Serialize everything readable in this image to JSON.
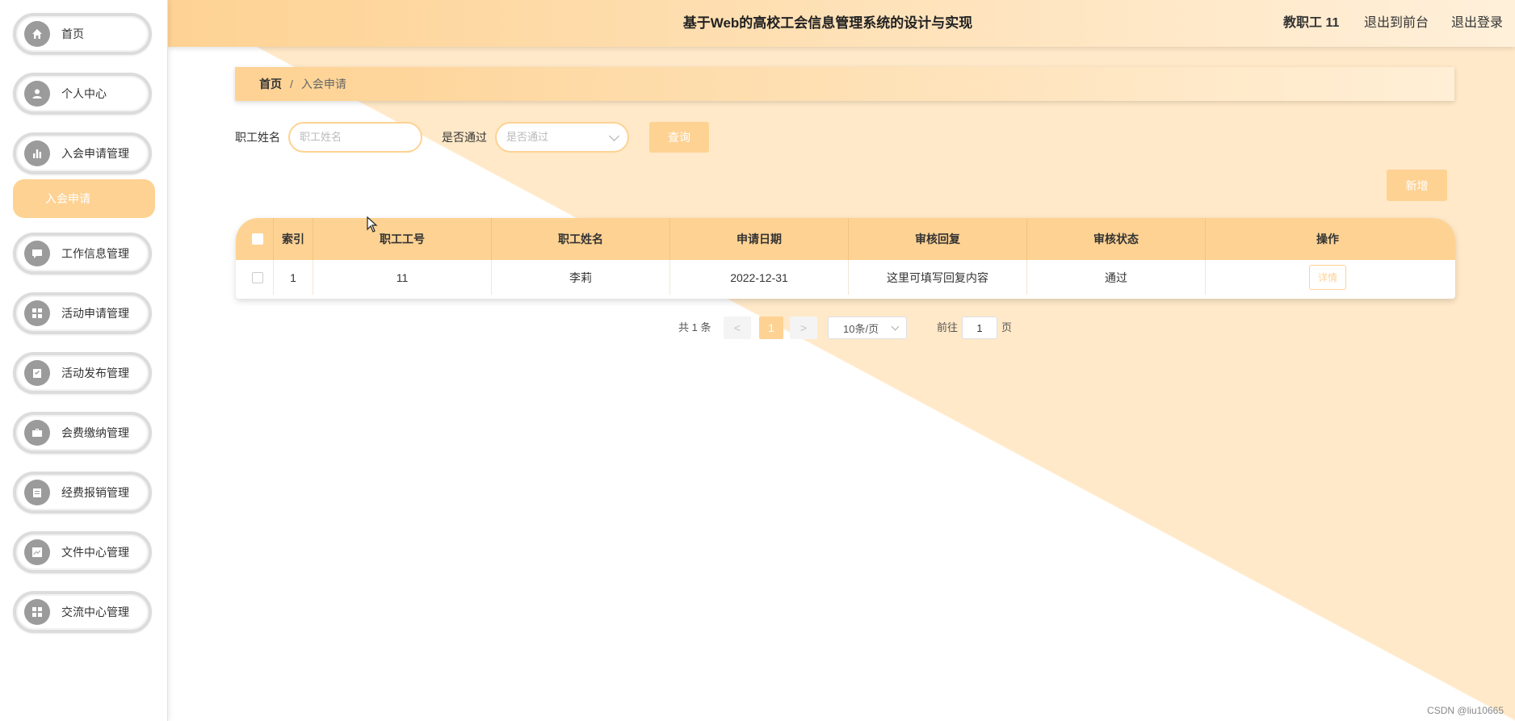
{
  "header": {
    "title": "基于Web的高校工会信息管理系统的设计与实现",
    "user": "教职工 11",
    "exit_front": "退出到前台",
    "logout": "退出登录"
  },
  "sidebar": {
    "items": [
      {
        "label": "首页",
        "icon": "home-icon"
      },
      {
        "label": "个人中心",
        "icon": "user-icon"
      },
      {
        "label": "入会申请管理",
        "icon": "chart-icon"
      },
      {
        "label": "工作信息管理",
        "icon": "chat-icon"
      },
      {
        "label": "活动申请管理",
        "icon": "grid-icon"
      },
      {
        "label": "活动发布管理",
        "icon": "clipboard-check-icon"
      },
      {
        "label": "会费缴纳管理",
        "icon": "briefcase-icon"
      },
      {
        "label": "经费报销管理",
        "icon": "clipboard-icon"
      },
      {
        "label": "文件中心管理",
        "icon": "trend-icon"
      },
      {
        "label": "交流中心管理",
        "icon": "grid-icon"
      }
    ],
    "submenu_active": "入会申请"
  },
  "breadcrumb": {
    "home": "首页",
    "separator": "/",
    "current": "入会申请"
  },
  "search": {
    "name_label": "职工姓名",
    "name_placeholder": "职工姓名",
    "passed_label": "是否通过",
    "passed_placeholder": "是否通过",
    "query_button": "查询",
    "add_button": "新增"
  },
  "table": {
    "columns": [
      "索引",
      "职工工号",
      "职工姓名",
      "申请日期",
      "审核回复",
      "审核状态",
      "操作"
    ],
    "rows": [
      {
        "index": "1",
        "staff_no": "11",
        "name": "李莉",
        "date": "2022-12-31",
        "reply": "这里可填写回复内容",
        "status": "通过",
        "action": "详情"
      }
    ]
  },
  "pagination": {
    "total": "共 1 条",
    "prev": "<",
    "current_page": "1",
    "next": ">",
    "page_size": "10条/页",
    "goto_label": "前往",
    "goto_value": "1",
    "page_unit": "页"
  },
  "watermark": "CSDN @liu10665",
  "colors": {
    "accent": "#fed293",
    "bg_tint": "#ffe9c8"
  }
}
